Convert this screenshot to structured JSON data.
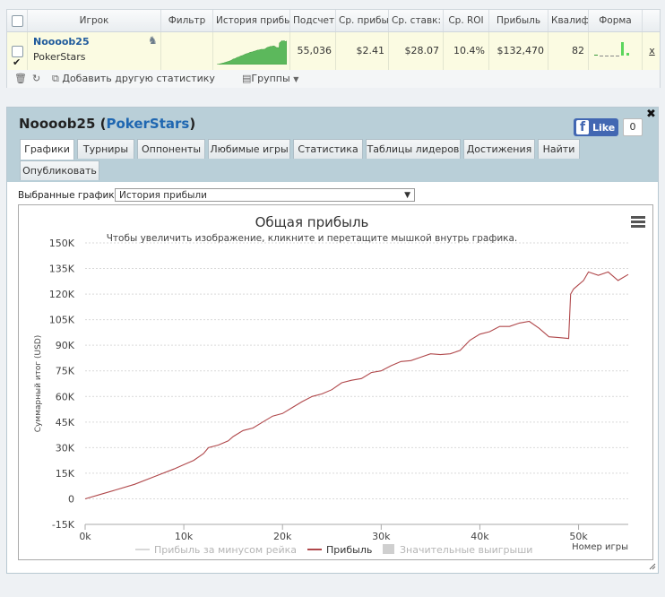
{
  "table": {
    "headers": [
      "Игрок",
      "Фильтр",
      "История прибыл",
      "Подсчет",
      "Ср. прибы",
      "Ср. ставк:",
      "Ср. ROI",
      "Прибыль",
      "Квалиф",
      "Форма"
    ],
    "row": {
      "player": "Noooob25",
      "site": "PokerStars",
      "count": "55,036",
      "avg_profit": "$2.41",
      "avg_stake": "$28.07",
      "avg_roi": "10.4%",
      "profit": "$132,470",
      "qualif": "82",
      "remove": "x"
    }
  },
  "toolbar": {
    "add_stat": "Добавить другую статистику",
    "groups": "Группы"
  },
  "panel": {
    "title_player": "Noooob25",
    "title_site": "PokerStars",
    "fb_like": "Like",
    "fb_count": "0",
    "tabs": [
      "Графики",
      "Турниры",
      "Оппоненты",
      "Любимые игры",
      "Статистика",
      "Таблицы лидеров",
      "Достижения",
      "Найти",
      "Опубликовать"
    ],
    "selected_label": "Выбранные графики:",
    "selected_value": "История прибыли"
  },
  "colors": {
    "profit_line": "#b0484b",
    "sparkline": "#5cb85c",
    "header_bg": "#b9cfd8"
  },
  "chart_data": {
    "type": "line",
    "title": "Общая прибыль",
    "subtitle": "Чтобы увеличить изображение, кликните и перетащите мышкой внутрь графика.",
    "xlabel": "Номер игры",
    "ylabel": "Суммарный итог (USD)",
    "xlim": [
      0,
      55036
    ],
    "ylim": [
      -15000,
      150000
    ],
    "x_ticks": [
      0,
      10000,
      20000,
      30000,
      40000,
      50000
    ],
    "x_tick_labels": [
      "0k",
      "10k",
      "20k",
      "30k",
      "40k",
      "50k"
    ],
    "y_ticks": [
      -15000,
      0,
      15000,
      30000,
      45000,
      60000,
      75000,
      90000,
      105000,
      120000,
      135000,
      150000
    ],
    "y_tick_labels": [
      "-15K",
      "0",
      "15K",
      "30K",
      "45K",
      "60K",
      "75K",
      "90K",
      "105K",
      "120K",
      "135K",
      "150K"
    ],
    "grid": true,
    "legend": [
      "Прибыль за минусом рейка",
      "Прибыль",
      "Значительные выигрыши"
    ],
    "series": [
      {
        "name": "Прибыль",
        "x": [
          0,
          1500,
          3000,
          5000,
          7000,
          9000,
          10000,
          11000,
          12000,
          12500,
          13500,
          14500,
          15000,
          16000,
          17000,
          18000,
          19000,
          20000,
          21000,
          22000,
          23000,
          24000,
          25000,
          26000,
          27000,
          28000,
          29000,
          30000,
          31000,
          32000,
          33000,
          34000,
          35000,
          36000,
          37000,
          38000,
          39000,
          40000,
          41000,
          42000,
          43000,
          44000,
          45000,
          46000,
          47000,
          48000,
          49000,
          49200,
          49500,
          50500,
          51000,
          52000,
          53000,
          54000,
          55036
        ],
        "y": [
          0,
          2500,
          5000,
          8500,
          13000,
          17500,
          20000,
          22500,
          26500,
          30000,
          31500,
          34000,
          36500,
          40000,
          41500,
          45000,
          48500,
          50000,
          53500,
          57000,
          60000,
          61500,
          64000,
          68000,
          69500,
          70500,
          74000,
          75000,
          78000,
          80500,
          81000,
          83000,
          85000,
          84500,
          85000,
          87000,
          93000,
          96500,
          98000,
          101000,
          101000,
          103000,
          104000,
          100000,
          95000,
          94500,
          94000,
          120000,
          123000,
          128000,
          133000,
          131000,
          133000,
          128000,
          131500
        ]
      }
    ]
  }
}
